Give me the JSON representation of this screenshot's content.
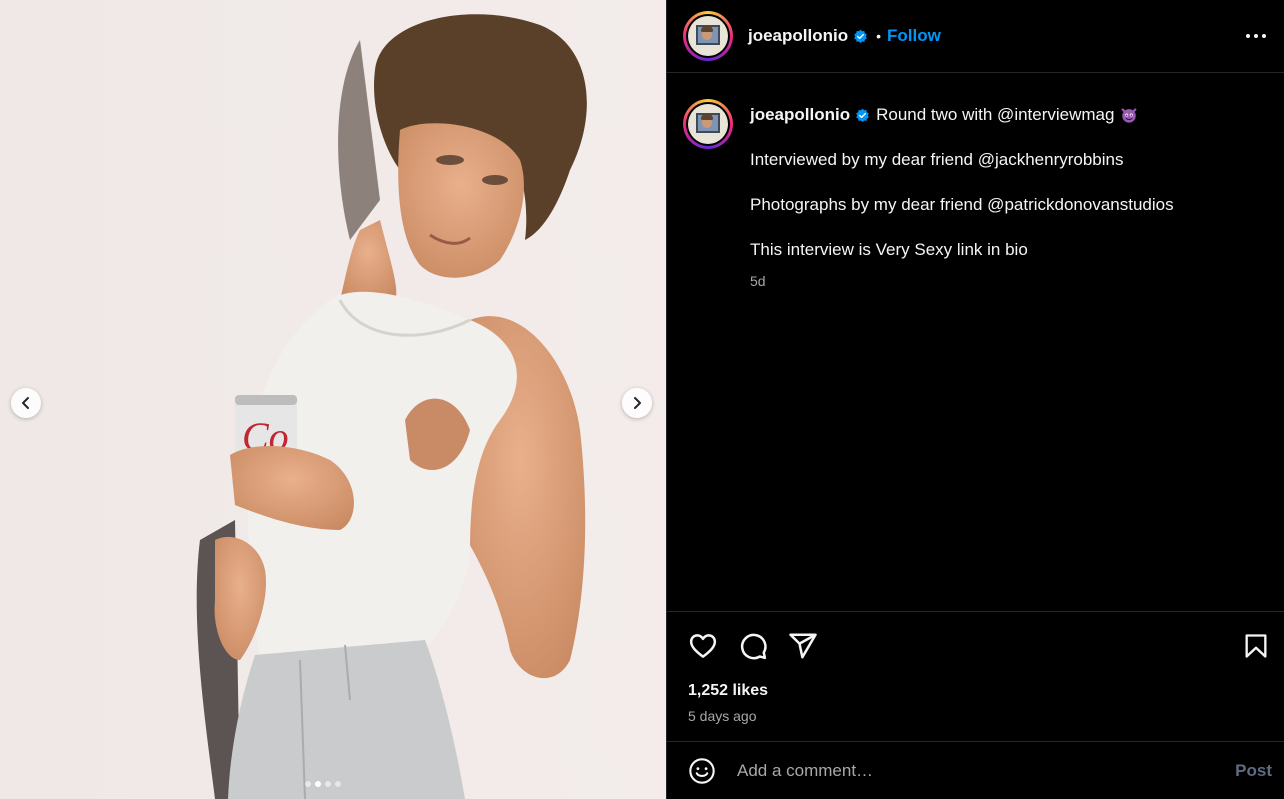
{
  "header": {
    "username": "joeapollonio",
    "separator": "•",
    "follow_label": "Follow"
  },
  "caption": {
    "username": "joeapollonio",
    "line1": "Round two with @interviewmag",
    "paragraphs": [
      "Interviewed by my dear friend @jackhenryrobbins",
      "Photographs by my dear friend @patrickdonovanstudios",
      "This interview is Very Sexy link in bio"
    ],
    "time": "5d"
  },
  "post": {
    "likes": "1,252 likes",
    "posted": "5 days ago"
  },
  "comment": {
    "placeholder": "Add a comment…",
    "post_label": "Post"
  },
  "carousel": {
    "slides": 4,
    "current_slide": 2
  },
  "colors": {
    "accent": "#0095f6",
    "verified": "#0095f6",
    "background": "#000000",
    "divider": "#262626",
    "muted_text": "#a8a8a8"
  },
  "icons": {
    "header": [
      "verified-badge-icon",
      "more-options-icon"
    ],
    "actions": [
      "heart-icon",
      "comment-icon",
      "share-icon",
      "bookmark-icon"
    ],
    "media": [
      "chevron-left-icon",
      "chevron-right-icon"
    ],
    "composer": [
      "emoji-icon"
    ]
  }
}
